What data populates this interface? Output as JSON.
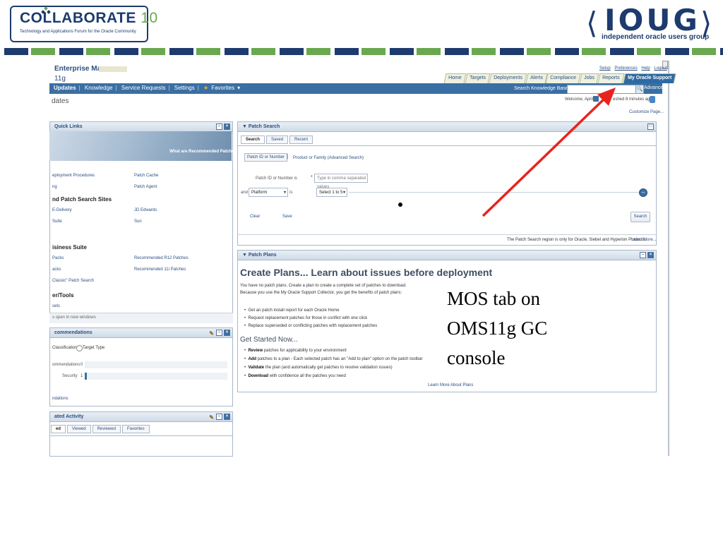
{
  "slide": {
    "caption": [
      "MOS tab on",
      "OMS11g GC",
      "console"
    ],
    "colors": {
      "navy": "#1d3b6e",
      "green": "#6aa84f",
      "arrow": "#e8231e"
    }
  },
  "collaborate_logo": {
    "title": "COLLABORATE",
    "number": "10",
    "subtitle": "Technology and Applications Forum for the Oracle Community"
  },
  "ioug_logo": {
    "left_bracket": "⟨",
    "word": "IOUG",
    "right_bracket": "⟩",
    "subtitle": "independent oracle users group"
  },
  "em": {
    "title": "Enterprise Manager",
    "version": "11g",
    "top_links": [
      "Setup",
      "Preferences",
      "Help",
      "Logout"
    ],
    "tabs": [
      "Home",
      "Targets",
      "Deployments",
      "Alerts",
      "Compliance",
      "Jobs",
      "Reports",
      "My Oracle Support"
    ],
    "active_tab": "My Oracle Support",
    "nav": {
      "items": [
        "Updates",
        "Knowledge",
        "Service Requests",
        "Settings",
        "Favorites"
      ],
      "favorites_arrow": "▾",
      "search_label": "Search Knowledge Base",
      "search_arrow": "▾",
      "search_button": "🔍",
      "advanced": "Advanced"
    },
    "page_subtitle": "dates",
    "welcome": "Welcome, April",
    "refreshed": "eshed 8 minutes ago",
    "customize": "Customize Page..."
  },
  "quick_links": {
    "title": "Quick Links",
    "banner": "What are Recommended Patches?",
    "row1": [
      "eployment Procedures",
      "Patch Cache"
    ],
    "row2": [
      "ng",
      "Patch Agent"
    ],
    "section1": "nd Patch Search Sites",
    "row3": [
      "E-Delivery",
      "JD Edwards"
    ],
    "row4": [
      "Suite",
      "Sun"
    ],
    "section2": "isiness Suite",
    "row5": [
      "Packs",
      "Recommended R12 Patches"
    ],
    "row6": [
      "acks",
      "Recommended 11i Patches"
    ],
    "row7": "Classic\" Patch Search",
    "section3": "er/Tools",
    "row8": "sets",
    "footer": "s open in new windows"
  },
  "recommendations": {
    "title": "commendations",
    "radio1": "Classification",
    "radio2": "Target Type",
    "row1_label": "ommendations",
    "row1_value": "0",
    "row2_label": "Security",
    "row2_value": "1",
    "footer": "ndations"
  },
  "activity": {
    "title": "ated Activity",
    "tabs": [
      "ed",
      "Viewed",
      "Reviewed",
      "Favorites"
    ]
  },
  "patch_search": {
    "title": "Patch Search",
    "tabs": [
      "Search",
      "Saved",
      "Recent"
    ],
    "modes": [
      "Patch ID or Number",
      "Product or Family (Advanced Search)"
    ],
    "field_label": "Patch ID or Number  is",
    "required_mark": "*",
    "field_placeholder": "Type in comma separated values",
    "and_label": "and",
    "platform_value": "Platform",
    "is_label": "is",
    "select_value": "Select 1 to 5",
    "clear": "Clear",
    "save": "Save",
    "search": "Search",
    "note": "The Patch Search region is only for Oracle, Siebel and Hyperion Products.",
    "learn_more": "Learn More..."
  },
  "patch_plans": {
    "title": "Patch Plans",
    "heading": "Create Plans... Learn about issues before deployment",
    "intro1": "You have no patch plans. Create a plan to create a complete set of patches to download.",
    "intro2": "Because you use the My Oracle Support Collector, you get the benefits of patch plans:",
    "benefits": [
      "Get an patch install report for each Oracle Home",
      "Request replacement patches for those in conflict with one click",
      "Replace superseded or conflicting patches with replacement patches"
    ],
    "started": "Get Started Now...",
    "steps": [
      {
        "bold": "Review",
        "text": " patches for applicability to your environment"
      },
      {
        "bold": "Add",
        "text": " patches to a plan - Each selected patch has an \"Add to plan\" option on the patch toolbar"
      },
      {
        "bold": "Validate",
        "text": " the plan (and automatically get patches to resolve validation issues)"
      },
      {
        "bold": "Download",
        "text": " with confidence all the patches you need"
      }
    ],
    "learn_more": "Learn More About Plans"
  }
}
